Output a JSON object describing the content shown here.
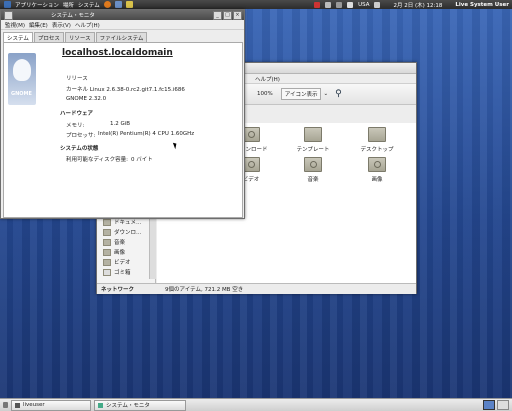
{
  "top_panel": {
    "menus": [
      "アプリケーション",
      "場所",
      "システム"
    ],
    "indicators": [
      "USA"
    ],
    "clock": "2月 2日 (木) 12:18",
    "user": "Live System User"
  },
  "bottom_panel": {
    "tasks": [
      "liveuser",
      "システム・モニタ"
    ]
  },
  "file_browser": {
    "menu": [
      "ヘルプ(H)"
    ],
    "toolbar": {
      "zoom": "100%",
      "view_mode": "アイコン表示"
    },
    "sidebar": {
      "items": [
        "ドキュメ…",
        "ダウンロ…",
        "音楽",
        "画像",
        "ビデオ",
        "ゴミ箱"
      ],
      "section": "ネットワーク"
    },
    "icons_row1": [
      "ダウンロード",
      "テンプレート",
      "デスクトップ"
    ],
    "icons_row2": [
      "ビデオ",
      "音楽",
      "画像"
    ],
    "status": "9個のアイテム, 721.2 MB 空き"
  },
  "system_monitor": {
    "title": "システム・モニタ",
    "menu": [
      "監視(M)",
      "編集(E)",
      "表示(V)",
      "ヘルプ(H)"
    ],
    "tabs": [
      "システム",
      "プロセス",
      "リソース",
      "ファイルシステム"
    ],
    "logo_text": "GNOME",
    "hostname": "localhost.localdomain",
    "release": "リリース",
    "kernel": "カーネル  Linux 2.6.38-0.rc2.git7.1.fc15.i686",
    "gnome_version": "GNOME  2.32.0",
    "hardware_heading": "ハードウェア",
    "memory_label": "メモリ:",
    "memory_value": "1.2 GiB",
    "processor_label": "プロセッサ:",
    "processor_value": "Intel(R) Pentium(R) 4 CPU 1.60GHz",
    "status_heading": "システムの状態",
    "disk_label": "利用可能なディスク容量:",
    "disk_value": "0 バイト"
  }
}
